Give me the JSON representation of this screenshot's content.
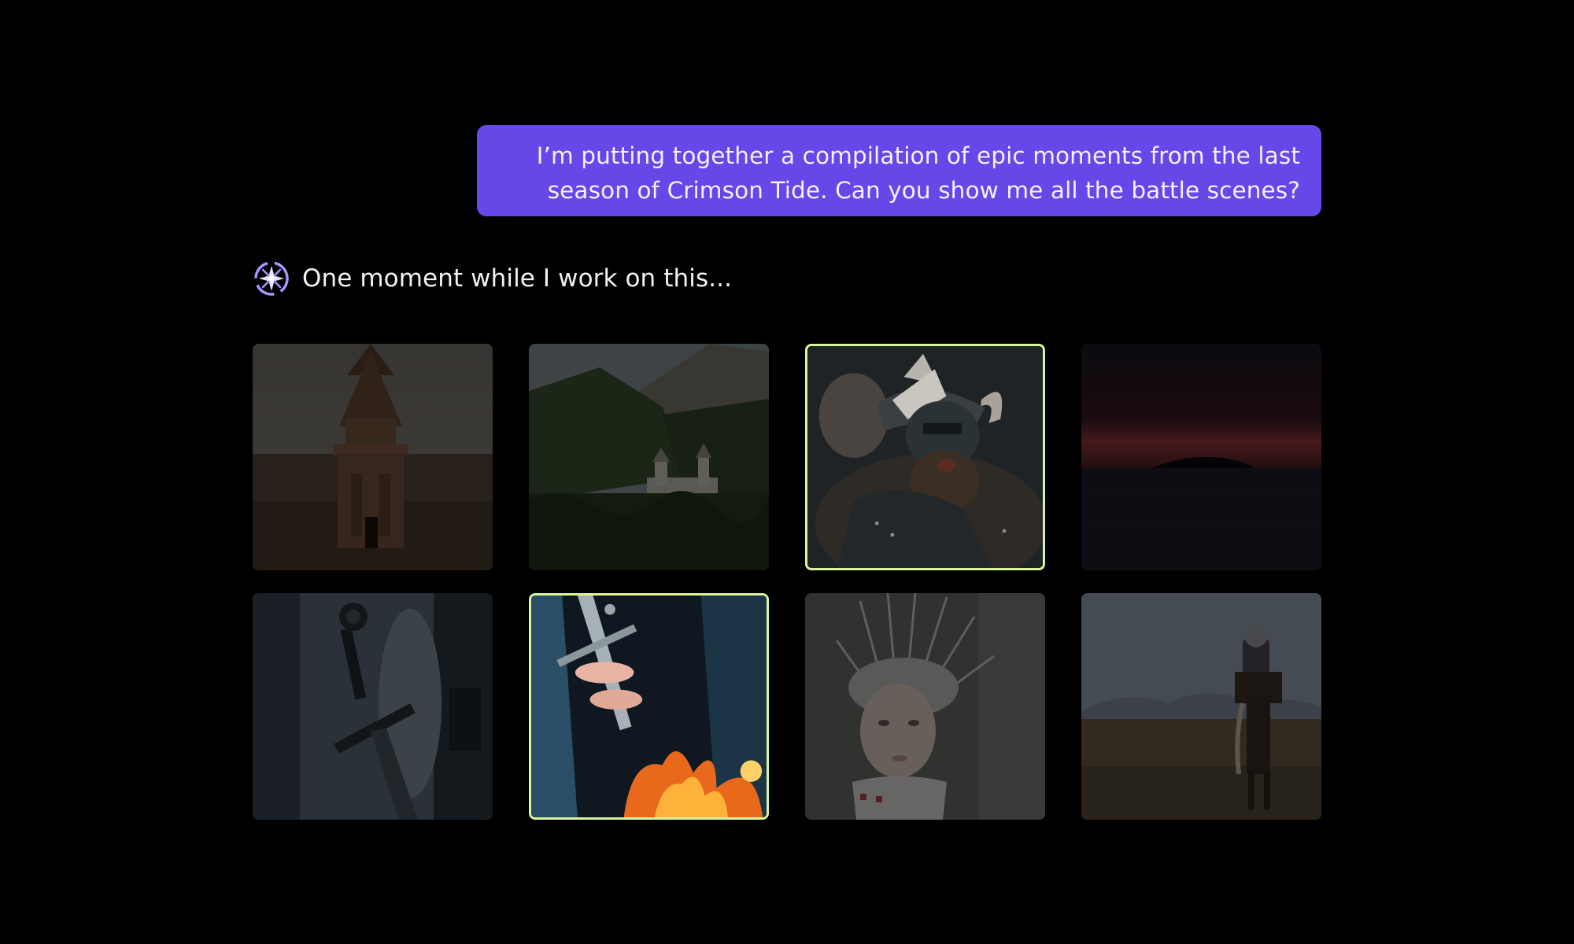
{
  "conversation": {
    "user_message": {
      "line1": "I’m putting together a compilation of epic moments from the last",
      "line2": "season of Crimson Tide. Can you show me all the battle scenes?"
    },
    "assistant_status": {
      "icon": "sparkle-badge-icon",
      "text": "One moment while I work on this..."
    }
  },
  "theme": {
    "background": "#000000",
    "user_bubble": "#6647e8",
    "brand_icon": "#a796ff",
    "selected_border": "#d8f59a"
  },
  "gallery": {
    "tiles": [
      {
        "scene": "stone-chapel-ruin",
        "selected": false
      },
      {
        "scene": "mountain-castle-forest",
        "selected": false
      },
      {
        "scene": "horned-helmet-warrior",
        "selected": true
      },
      {
        "scene": "red-horizon-sea",
        "selected": false
      },
      {
        "scene": "sword-in-snow",
        "selected": false
      },
      {
        "scene": "hands-on-sword-fire",
        "selected": true
      },
      {
        "scene": "crowned-queen",
        "selected": false
      },
      {
        "scene": "knight-on-horse",
        "selected": false
      }
    ]
  }
}
